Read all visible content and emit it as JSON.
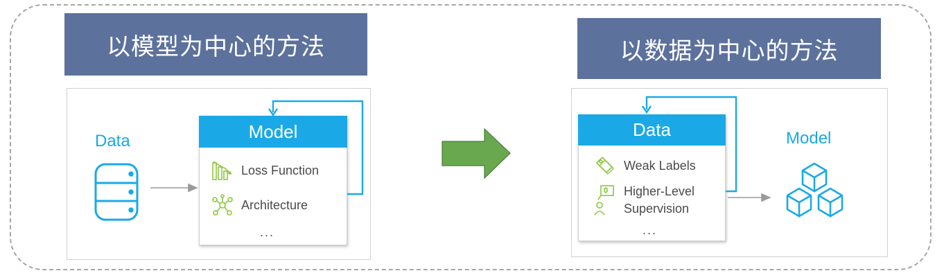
{
  "left": {
    "banner_title": "以模型为中心的方法",
    "data_label": "Data",
    "model_box": {
      "title": "Model",
      "items": [
        {
          "label": "Loss Function",
          "icon": "bar-chart-icon"
        },
        {
          "label": "Architecture",
          "icon": "network-icon"
        }
      ],
      "more": "..."
    }
  },
  "right": {
    "banner_title": "以数据为中心的方法",
    "model_label": "Model",
    "data_box": {
      "title": "Data",
      "items": [
        {
          "label": "Weak Labels",
          "icon": "tag-icon"
        },
        {
          "label": "Higher-Level\nSupervision",
          "icon": "supervisor-icon"
        }
      ],
      "more": "..."
    }
  },
  "colors": {
    "banner": "#5c719c",
    "accent_blue": "#1aa9e6",
    "icon_green": "#8cc63f",
    "transition_arrow": "#6aa84f"
  }
}
